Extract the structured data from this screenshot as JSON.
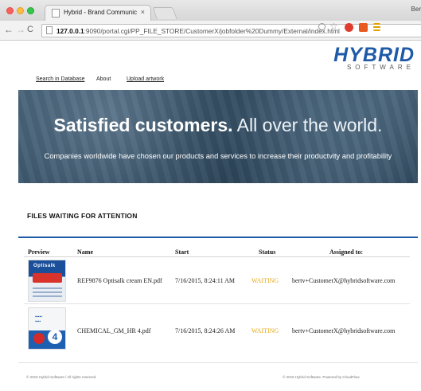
{
  "browser": {
    "tab_title": "Hybrid - Brand Communic",
    "tab_close": "×",
    "profile_label": "Ber",
    "url_host": "127.0.0.1",
    "url_path": ":9090/portal.cgi/PP_FILE_STORE/CustomerX/jobfolder%20Dummy/External/index.html",
    "nav": {
      "back": "←",
      "forward": "→",
      "reload": "C"
    }
  },
  "logo": {
    "main": "HYBRID",
    "sub": "SOFTWARE"
  },
  "topnav": {
    "search": "Search in Database",
    "about": "About",
    "upload": "Upload artwork"
  },
  "hero": {
    "title_bold": "Satisfied customers.",
    "title_light": " All over the world.",
    "subtitle": "Companies worldwide have chosen our products and services to increase their productvity and profitability"
  },
  "section": {
    "title": "FILES WAITING FOR ATTENTION"
  },
  "table": {
    "headers": {
      "preview": "Preview",
      "name": "Name",
      "start": "Start",
      "status": "Status",
      "assigned": "Assigned to:"
    },
    "rows": [
      {
        "name": "REF9876 Optisalk cream EN.pdf",
        "start": "7/16/2015, 8:24:11 AM",
        "status": "WAITING",
        "assigned": "bertv+CustomerX@hybridsoftware.com",
        "thumb_brand": "Optisalk"
      },
      {
        "name": "CHEMICAL_GM_HR 4.pdf",
        "start": "7/16/2015, 8:24:26 AM",
        "status": "WAITING",
        "assigned": "bertv+CustomerX@hybridsoftware.com",
        "thumb_num": "4"
      }
    ]
  },
  "footer": {
    "left": "© 2015 Hybrid Software / All rights reserved",
    "right": "© 2015 Hybrid Software. Powered by CloudFlow"
  },
  "colors": {
    "accent": "#1e5aa8",
    "status_waiting": "#e8a818"
  },
  "icons": [
    "page-icon",
    "search-icon",
    "star-icon",
    "extension-icon",
    "menu-icon"
  ]
}
